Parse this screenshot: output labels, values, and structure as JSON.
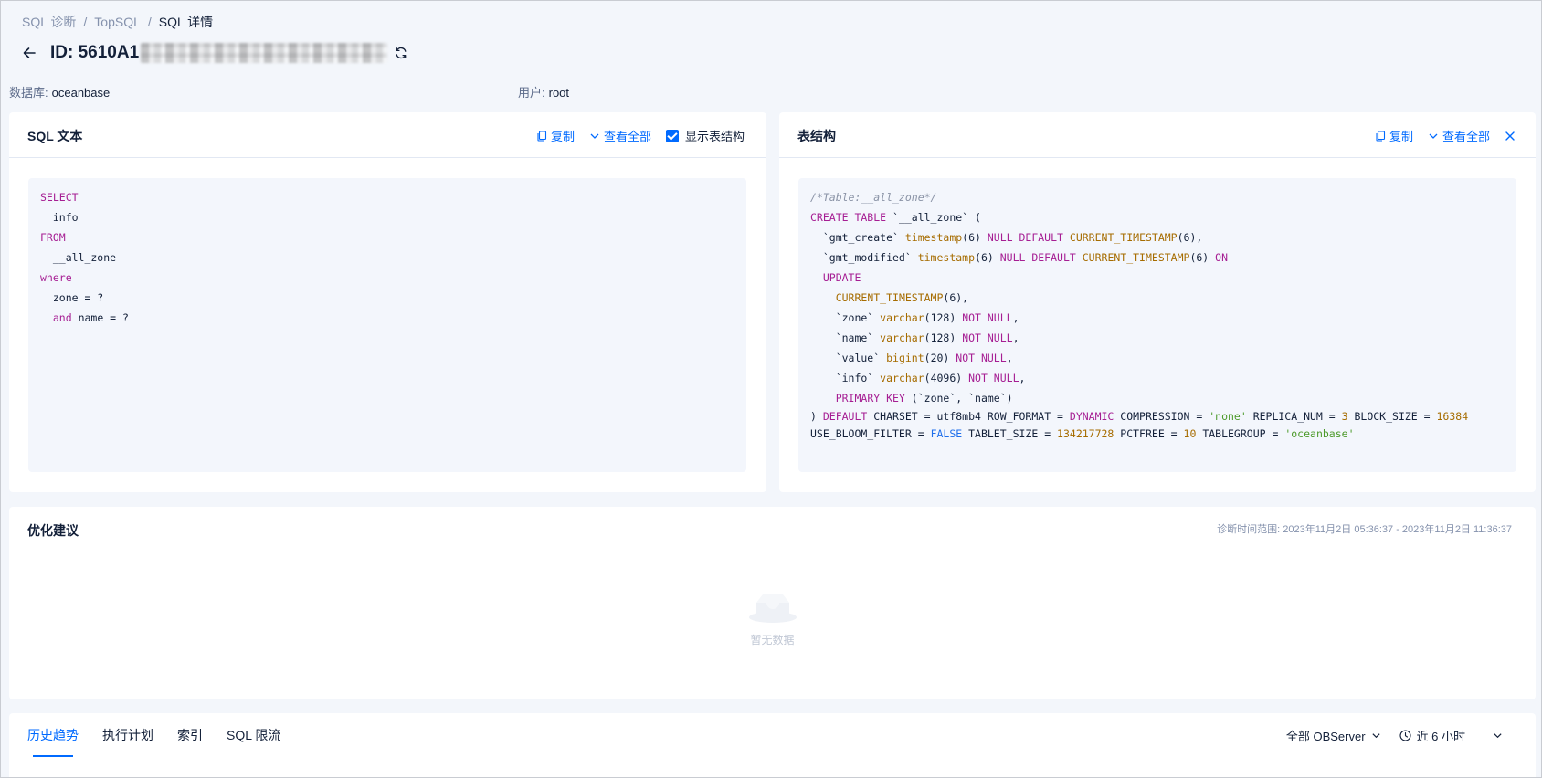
{
  "breadcrumb": {
    "items": [
      "SQL 诊断",
      "TopSQL",
      "SQL 详情"
    ],
    "separator": "/"
  },
  "header": {
    "title_prefix": "ID: 5610A1"
  },
  "meta": {
    "database_label": "数据库:",
    "database_value": "oceanbase",
    "user_label": "用户:",
    "user_value": "root"
  },
  "sql_card": {
    "title": "SQL 文本",
    "copy_label": "复制",
    "view_all_label": "查看全部",
    "show_schema_label": "显示表结构"
  },
  "schema_card": {
    "title": "表结构",
    "copy_label": "复制",
    "view_all_label": "查看全部"
  },
  "advice_card": {
    "title": "优化建议",
    "range_label": "诊断时间范围: 2023年11月2日 05:36:37 - 2023年11月2日 11:36:37",
    "empty_text": "暂无数据"
  },
  "bottom": {
    "tabs": [
      "历史趋势",
      "执行计划",
      "索引",
      "SQL 限流"
    ],
    "server_select": "全部 OBServer",
    "time_select": "近 6 小时"
  },
  "colors": {
    "primary": "#006aff",
    "keyword": "#a61e93",
    "function": "#a66c00",
    "string": "#4c9a2a",
    "boolean": "#1f6feb"
  }
}
